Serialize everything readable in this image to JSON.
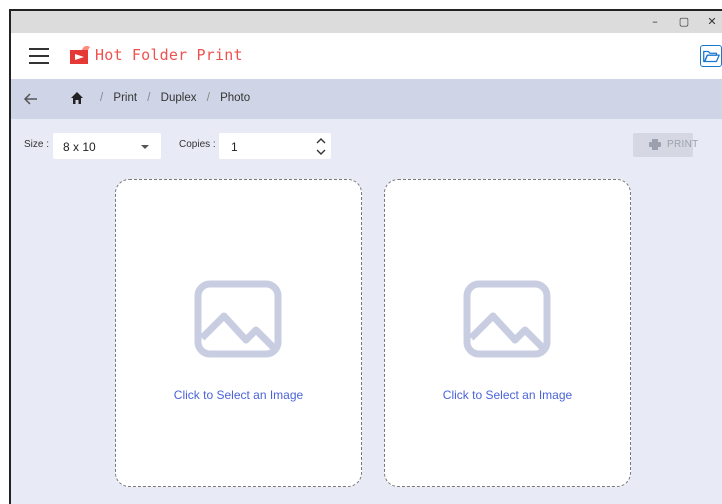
{
  "window": {
    "controls": {
      "minimize": "–",
      "maximize": "▢",
      "close": "✕"
    }
  },
  "header": {
    "menu_icon": "hamburger-menu-icon",
    "logo_icon": "hot-folder-print-logo",
    "title": "Hot Folder Print",
    "title_color": "#ef5350",
    "open_folder_icon": "folder-open-icon"
  },
  "breadcrumb": {
    "back_icon": "arrow-left-icon",
    "home_icon": "home-icon",
    "items": [
      "Print",
      "Duplex",
      "Photo"
    ],
    "separator": "/"
  },
  "toolbar": {
    "size_label": "Size :",
    "size_value": "8 x 10",
    "copies_label": "Copies :",
    "copies_value": "1",
    "print_label": "PRINT",
    "print_enabled": false
  },
  "cards": [
    {
      "placeholder_icon": "image-placeholder-icon",
      "label": "Click to Select an Image"
    },
    {
      "placeholder_icon": "image-placeholder-icon",
      "label": "Click to Select an Image"
    }
  ],
  "colors": {
    "accent": "#4a63d8",
    "brand": "#ef5350",
    "background": "#e8eaf6",
    "breadcrumb_bar": "#cfd4e6"
  }
}
